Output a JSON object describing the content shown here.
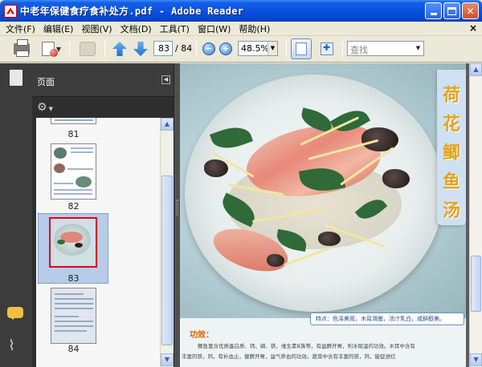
{
  "window": {
    "title": "中老年保健食疗食补处方.pdf - Adobe Reader"
  },
  "menu": {
    "items": [
      "文件(F)",
      "编辑(E)",
      "视图(V)",
      "文档(D)",
      "工具(T)",
      "窗口(W)",
      "帮助(H)"
    ],
    "close_glyph": "×"
  },
  "toolbar": {
    "current_page": "83",
    "total_pages": "/ 84",
    "zoom": "48.5%",
    "zoom_out": "−",
    "zoom_in": "+",
    "search_placeholder": "查找"
  },
  "panel": {
    "title": "页面",
    "thumbnails": [
      {
        "label": "81"
      },
      {
        "label": "82"
      },
      {
        "label": "83"
      },
      {
        "label": "84"
      }
    ]
  },
  "document": {
    "title_chars": [
      "荷",
      "花",
      "鲫",
      "鱼",
      "汤"
    ],
    "caption": "特点：色泽美观，木耳滑脆，汤汁乳白，咸鲜醇美。",
    "efficacy_label": "功效：",
    "body_lines": [
      "鲫鱼富含优质蛋白质、钙、磷、铁、维生素B族等，有益脾开胃，利水除湿的功效。木耳中含有",
      "丰富的铁，钙，有补血止，健脾开胃，益气养血的功效。蔬菜中含有丰富的铁，钙，能促进红"
    ]
  },
  "colors": {
    "title_bar": "#0a52e0",
    "nav_bg": "#3c3c3c",
    "selection": "#b7cce8",
    "dish_title": "#e5a21c"
  }
}
